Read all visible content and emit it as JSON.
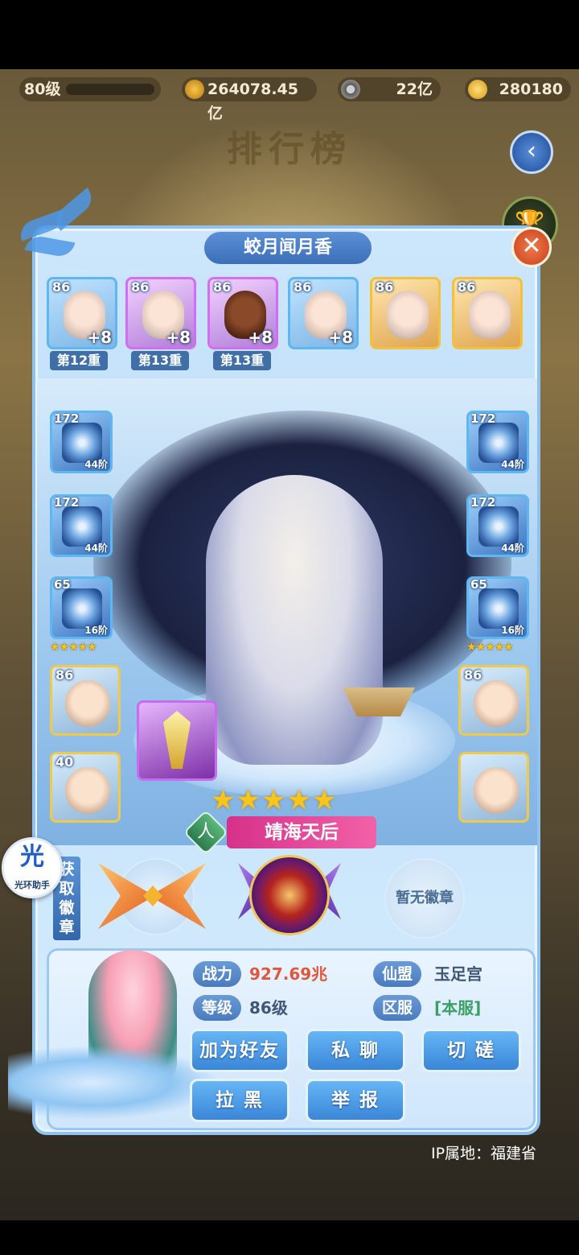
{
  "topbar": {
    "level": "80级",
    "power": "264078.45亿",
    "coins": "22亿",
    "gold": "280180"
  },
  "banner": {
    "title": "排行榜"
  },
  "player": {
    "name": "蛟月闻月香",
    "heroes": [
      {
        "level": "86",
        "plus": "+8",
        "tier": "第12重",
        "frame": "blue"
      },
      {
        "level": "86",
        "plus": "+8",
        "tier": "第13重",
        "frame": "purple"
      },
      {
        "level": "86",
        "plus": "+8",
        "tier": "第13重",
        "frame": "purple"
      },
      {
        "level": "86",
        "plus": "+8",
        "tier": "",
        "frame": "blue"
      },
      {
        "level": "86",
        "plus": "",
        "tier": "",
        "frame": "gold"
      },
      {
        "level": "86",
        "plus": "",
        "tier": "",
        "frame": "gold"
      }
    ]
  },
  "equipment": {
    "left": [
      {
        "level": "172",
        "step": "44阶"
      },
      {
        "level": "172",
        "step": "44阶"
      },
      {
        "level": "65",
        "step": "16阶",
        "stars": "★★★★★"
      }
    ],
    "right": [
      {
        "level": "172",
        "step": "44阶"
      },
      {
        "level": "172",
        "step": "44阶"
      },
      {
        "level": "65",
        "step": "16阶",
        "stars": "★★★★★"
      }
    ]
  },
  "pets": {
    "left": [
      {
        "level": "86"
      },
      {
        "level": "40"
      }
    ],
    "right": [
      {
        "level": "86"
      },
      {
        "level": ""
      }
    ]
  },
  "hero_main": {
    "stars": "★★★★★",
    "faction": "人",
    "name": "靖海天后"
  },
  "badges": {
    "side_label": "获取徽章",
    "no_badge": "暂无徽章"
  },
  "info": {
    "power_label": "战力",
    "power_value": "927.69兆",
    "alliance_label": "仙盟",
    "alliance_value": "玉足宫",
    "level_label": "等级",
    "level_value": "86级",
    "server_label": "区服",
    "server_value": "[本服]"
  },
  "actions": {
    "add_friend": "加为好友",
    "private_chat": "私 聊",
    "duel": "切 磋",
    "block": "拉 黑",
    "report": "举 报"
  },
  "ip": "IP属地：福建省",
  "helper": {
    "big": "光",
    "small": "光环助手"
  },
  "colors": {
    "panel_border": "#8fc2ef",
    "name_plate": "#3b6fb8",
    "hero_name_bg": "#d6318a",
    "power_text": "#e0583c",
    "server_text": "#3aa063"
  }
}
